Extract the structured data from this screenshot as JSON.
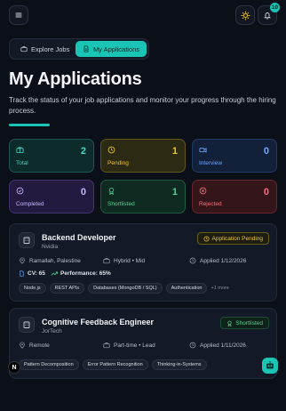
{
  "header": {
    "menu_icon": "menu-icon",
    "theme_icon": "sun-icon",
    "notification_icon": "bell-icon",
    "notification_count": "10"
  },
  "tabs": [
    {
      "label": "Explore Jobs",
      "icon": "briefcase-icon",
      "active": false
    },
    {
      "label": "My Applications",
      "icon": "document-icon",
      "active": true
    }
  ],
  "page": {
    "title": "My Applications",
    "subtitle": "Track the status of your job applications and monitor your progress through the hiring process."
  },
  "stats": [
    {
      "label": "Total",
      "value": "2",
      "icon": "briefcase-icon"
    },
    {
      "label": "Pending",
      "value": "1",
      "icon": "clock-icon"
    },
    {
      "label": "Interview",
      "value": "0",
      "icon": "video-icon"
    },
    {
      "label": "Completed",
      "value": "0",
      "icon": "check-circle-icon"
    },
    {
      "label": "Shortlisted",
      "value": "1",
      "icon": "award-icon"
    },
    {
      "label": "Rejected",
      "value": "0",
      "icon": "x-circle-icon"
    }
  ],
  "applications": [
    {
      "title": "Backend Developer",
      "company": "Nvidia",
      "status": "Application Pending",
      "location": "Ramallah, Palestine",
      "type": "Hybrid • Mid",
      "applied": "Applied 1/12/2026",
      "cv": "CV: 65",
      "performance": "Performance: 65%",
      "skills": [
        "Node.js",
        "REST APIs",
        "Databases (MongoDB / SQL)",
        "Authentication"
      ],
      "more": "+1 more"
    },
    {
      "title": "Cognitive Feedback Engineer",
      "company": "JorTech",
      "status": "Shortlisted",
      "location": "Remote",
      "type": "Part-time • Lead",
      "applied": "Applied 1/11/2026",
      "skills": [
        "Pattern Decomposition",
        "Error Pattern Recognition",
        "Thinking-in-Systems"
      ]
    }
  ],
  "floating": {
    "next_badge": "N",
    "assistant_icon": "robot-icon"
  },
  "colors": {
    "accent": "#19c6b6",
    "background": "#0b0f17",
    "pending": "#f1c526",
    "shortlisted": "#4ed38f",
    "rejected": "#ff6b7a",
    "interview": "#6ea8ff",
    "completed": "#c8b5ff"
  }
}
